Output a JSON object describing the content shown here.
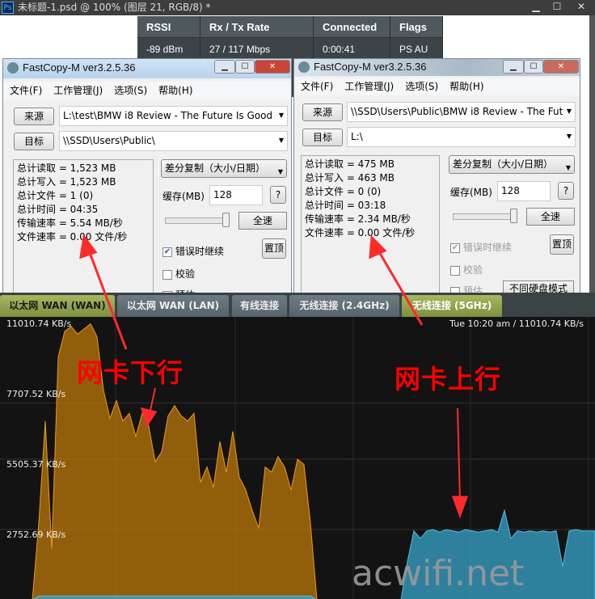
{
  "photoshop": {
    "title": "未标题-1.psd @ 100% (图层 21, RGB/8) *",
    "logo": "Ps",
    "buttons": [
      "minimize",
      "maximize",
      "close"
    ]
  },
  "client_table": {
    "headers": [
      "RSSI",
      "Rx / Tx Rate",
      "Connected",
      "Flags"
    ],
    "row": [
      "-89 dBm",
      "27 / 117 Mbps",
      "0:00:41",
      "PS AU"
    ]
  },
  "windows": [
    {
      "title": "FastCopy-M ver3.2.5.36",
      "menu": [
        "文件(F)",
        "工作管理(J)",
        "选项(S)",
        "帮助(H)"
      ],
      "source_label": "来源",
      "source": "L:\\test\\BMW i8 Review - The Future Is Good",
      "dest_label": "目标",
      "dest": "\\\\SSD\\Users\\Public\\",
      "stats": [
        "总计读取 = 1,523 MB",
        "总计写入 = 1,523 MB",
        "总计文件 = 1 (0)",
        "总计时间 = 04:35",
        "传输速率 = 5.54 MB/秒",
        "文件速率 = 0.00 文件/秒"
      ],
      "mode": "差分复制（大小/日期）",
      "buffer_label": "缓存(MB)",
      "buffer": "128",
      "help": "?",
      "fullspeed": "全速",
      "continue_on_error": "错误时继续",
      "continue_checked": true,
      "top": "置顶",
      "verify": "校验",
      "estimate": "预估"
    },
    {
      "title": "FastCopy-M ver3.2.5.36",
      "menu": [
        "文件(F)",
        "工作管理(J)",
        "选项(S)",
        "帮助(H)"
      ],
      "source_label": "来源",
      "source": "\\\\SSD\\Users\\Public\\BMW i8 Review - The Fut",
      "dest_label": "目标",
      "dest": "L:\\",
      "stats": [
        "总计读取 = 475 MB",
        "总计写入 = 463 MB",
        "总计文件 = 0 (0)",
        "总计时间 = 03:18",
        "传输速率 = 2.34 MB/秒",
        "文件速率 = 0.00 文件/秒"
      ],
      "mode": "差分复制（大小/日期）",
      "buffer_label": "缓存(MB)",
      "buffer": "128",
      "help": "?",
      "fullspeed": "全速",
      "continue_on_error": "错误时继续",
      "continue_checked": true,
      "top": "置顶",
      "verify": "校验",
      "estimate": "预估",
      "disk_mode": "不同硬盘模式"
    }
  ],
  "tabs": [
    {
      "label": "以太网 WAN (WAN)",
      "active": true
    },
    {
      "label": "以太网 WAN (LAN)"
    },
    {
      "label": "有线连接"
    },
    {
      "label": "无线连接 (2.4GHz)"
    },
    {
      "label": "无线连接 (5GHz)",
      "active": true
    }
  ],
  "graph": {
    "top_left": "11010.74 KB/s",
    "top_right": "Tue 10:20 am / 11010.74 KB/s",
    "y_labels": [
      "7707.52 KB/s",
      "5505.37 KB/s",
      "2752.69 KB/s"
    ]
  },
  "annotations": {
    "down": "网卡下行",
    "up": "网卡上行",
    "color": "#ff0000"
  },
  "watermark": "acwifi.net",
  "chart_data": {
    "type": "area",
    "ylim": [
      0,
      11010.74
    ],
    "yticks": [
      2752.69,
      5505.37,
      7707.52,
      11010.74
    ],
    "unit": "KB/s",
    "series": [
      {
        "color": "#c87f0a",
        "values": [
          0,
          0,
          0,
          0,
          0,
          0,
          3000,
          7000,
          2000,
          9500,
          10500,
          10700,
          10400,
          10600,
          10800,
          10300,
          8200,
          7100,
          7800,
          7000,
          7300,
          6400,
          7300,
          6800,
          5400,
          5800,
          7200,
          7600,
          7200,
          7000,
          7300,
          4600,
          5200,
          4400,
          6200,
          5000,
          6600,
          4800,
          4300,
          3500,
          2800,
          5200,
          5000,
          5600,
          5200,
          4300,
          5500,
          5300,
          3000,
          0,
          0,
          0,
          0,
          0,
          0,
          0,
          0,
          0,
          0,
          0,
          0,
          0,
          0,
          0,
          0,
          0,
          0,
          0,
          0,
          0,
          0,
          0,
          0,
          0,
          0,
          0,
          0,
          0,
          0,
          0,
          0,
          0,
          0,
          0,
          0,
          0,
          0,
          0,
          0,
          0,
          0,
          0
        ]
      },
      {
        "color": "#3aa6cc",
        "values": [
          0,
          0,
          0,
          0,
          0,
          0,
          150,
          150,
          150,
          150,
          150,
          150,
          150,
          150,
          150,
          150,
          150,
          150,
          150,
          150,
          150,
          150,
          150,
          150,
          150,
          150,
          150,
          150,
          150,
          150,
          150,
          150,
          150,
          150,
          150,
          150,
          150,
          150,
          150,
          150,
          150,
          150,
          150,
          150,
          150,
          150,
          150,
          150,
          150,
          0,
          0,
          0,
          0,
          0,
          0,
          0,
          0,
          0,
          0,
          0,
          0,
          0,
          0,
          1500,
          2700,
          2400,
          2700,
          2750,
          2650,
          2750,
          2700,
          2650,
          2750,
          2700,
          2650,
          2700,
          2750,
          2650,
          3500,
          2400,
          2700,
          2650,
          2700,
          2650,
          2700,
          2650,
          2700,
          1300,
          2700,
          2750,
          2700,
          2700
        ]
      }
    ]
  }
}
